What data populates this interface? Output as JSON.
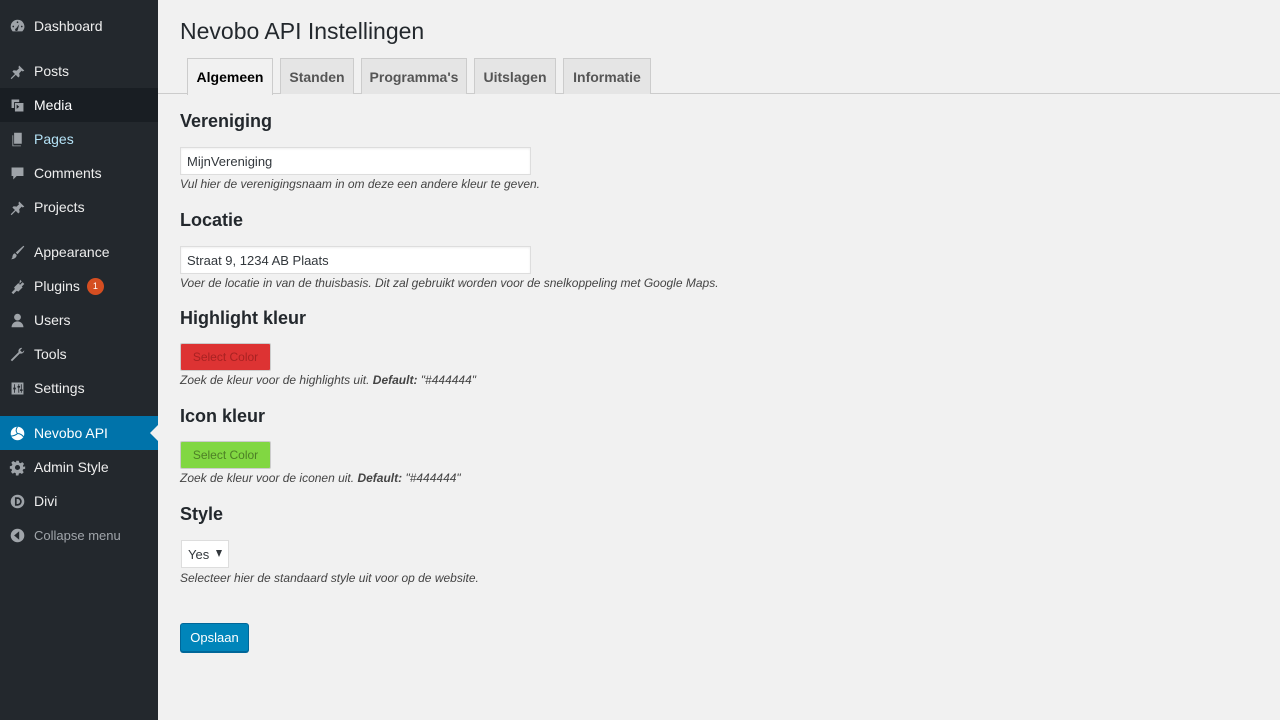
{
  "sidebar": {
    "items": [
      {
        "label": "Dashboard",
        "icon": "dashboard-icon"
      },
      {
        "label": "Posts",
        "icon": "pin-icon"
      },
      {
        "label": "Media",
        "icon": "media-icon"
      },
      {
        "label": "Pages",
        "icon": "pages-icon"
      },
      {
        "label": "Comments",
        "icon": "comments-icon"
      },
      {
        "label": "Projects",
        "icon": "pin-icon"
      },
      {
        "label": "Appearance",
        "icon": "paintbrush-icon"
      },
      {
        "label": "Plugins",
        "icon": "plugin-icon",
        "badge": "1"
      },
      {
        "label": "Users",
        "icon": "user-icon"
      },
      {
        "label": "Tools",
        "icon": "wrench-icon"
      },
      {
        "label": "Settings",
        "icon": "sliders-icon"
      },
      {
        "label": "Nevobo API",
        "icon": "volleyball-icon"
      },
      {
        "label": "Admin Style",
        "icon": "gear-icon"
      },
      {
        "label": "Divi",
        "icon": "divi-icon"
      },
      {
        "label": "Collapse menu",
        "icon": "collapse-icon"
      }
    ]
  },
  "page": {
    "title": "Nevobo API Instellingen"
  },
  "tabs": [
    {
      "label": "Algemeen",
      "active": true
    },
    {
      "label": "Standen"
    },
    {
      "label": "Programma's"
    },
    {
      "label": "Uitslagen"
    },
    {
      "label": "Informatie"
    }
  ],
  "form": {
    "vereniging": {
      "heading": "Vereniging",
      "value": "MijnVereniging",
      "description": "Vul hier de verenigingsnaam in om deze een andere kleur te geven."
    },
    "locatie": {
      "heading": "Locatie",
      "value": "Straat 9, 1234 AB Plaats",
      "description": "Voer de locatie in van de thuisbasis. Dit zal gebruikt worden voor de snelkoppeling met Google Maps."
    },
    "highlight": {
      "heading": "Highlight kleur",
      "button_label": "Select Color",
      "color": "#dd3333",
      "description_pre": "Zoek de kleur voor de highlights uit. ",
      "default_label": "Default:",
      "default_value": " \"#444444\""
    },
    "icon": {
      "heading": "Icon kleur",
      "button_label": "Select Color",
      "color": "#81d742",
      "description_pre": "Zoek de kleur voor de iconen uit. ",
      "default_label": "Default:",
      "default_value": " \"#444444\""
    },
    "style": {
      "heading": "Style",
      "selected": "Yes",
      "description": "Selecteer hier de standaard style uit voor op de website."
    },
    "save_label": "Opslaan"
  },
  "colors": {
    "sidebar_bg": "#23282d",
    "accent": "#0073aa",
    "primary_button": "#0085ba",
    "badge": "#d54e21"
  }
}
